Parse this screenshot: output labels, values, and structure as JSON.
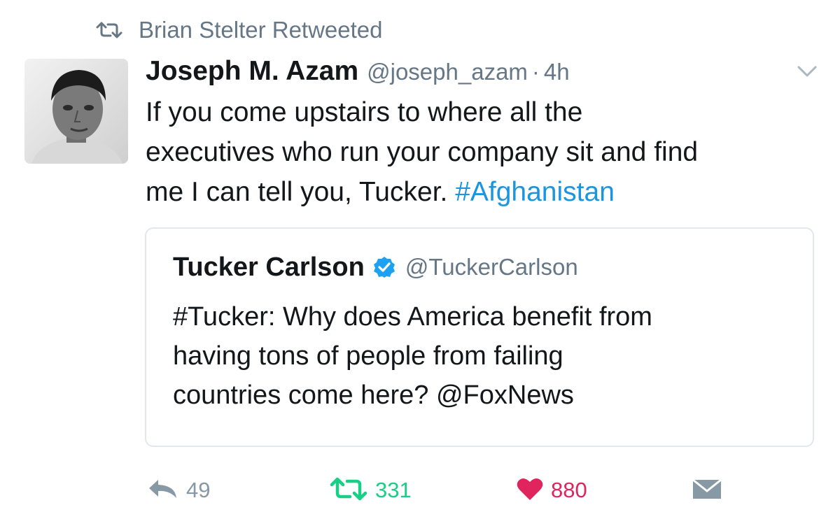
{
  "retweet_context": {
    "label": "Brian Stelter Retweeted",
    "icon": "retweet-icon"
  },
  "tweet": {
    "author_name": "Joseph M. Azam",
    "author_handle": "@joseph_azam",
    "separator": "·",
    "time": "4h",
    "text_lines": [
      "If you come upstairs to where all the",
      "executives who run your company sit and find",
      "me I can tell you, Tucker. "
    ],
    "hashtag": "#Afghanistan",
    "menu_icon": "chevron-down-icon"
  },
  "quoted_tweet": {
    "author_name": "Tucker Carlson",
    "verified_icon": "verified-badge-icon",
    "author_handle": "@TuckerCarlson",
    "text_lines": [
      "#Tucker: Why does America benefit from",
      "having tons of people from failing",
      "countries come here?  @FoxNews"
    ]
  },
  "actions": {
    "reply_count": "49",
    "retweet_count": "331",
    "like_count": "880",
    "colors": {
      "muted": "#8899a6",
      "retweet": "#19cf86",
      "like": "#e0245e",
      "link": "#1b95e0"
    }
  }
}
